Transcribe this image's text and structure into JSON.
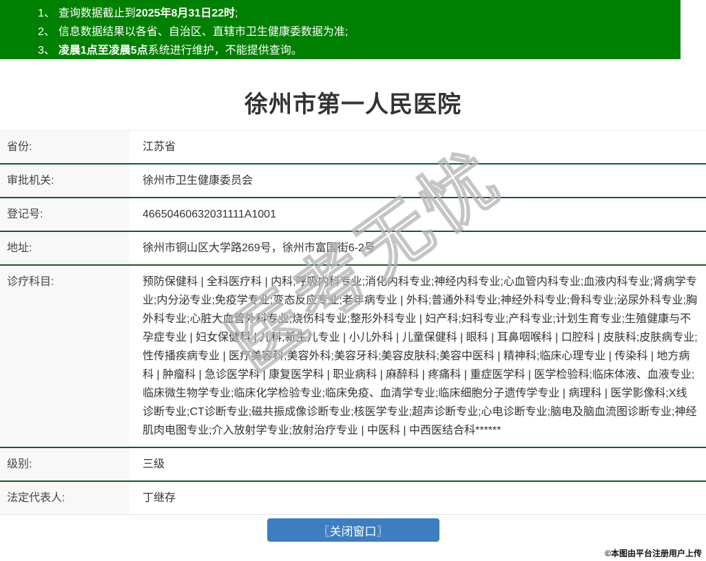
{
  "banner": {
    "notices": [
      {
        "num": "1、",
        "pre": "查询数据截止到",
        "bold": "2025年8月31日22时",
        "post": ";"
      },
      {
        "num": "2、",
        "pre": "信息数据结果以各省、自治区、直辖市卫生健康委数据为准;",
        "bold": "",
        "post": ""
      },
      {
        "num": "3、",
        "pre": "",
        "bold": "凌晨1点至凌晨5点",
        "post": "系统进行维护，不能提供查询。"
      }
    ]
  },
  "page": {
    "title": "徐州市第一人民医院"
  },
  "table": {
    "rows": [
      {
        "label": "省份:",
        "value": "江苏省"
      },
      {
        "label": "审批机关:",
        "value": "徐州市卫生健康委员会"
      },
      {
        "label": "登记号:",
        "value": "46650460632031111A1001"
      },
      {
        "label": "地址:",
        "value": "徐州市铜山区大学路269号，徐州市富国街6-2号"
      },
      {
        "label": "诊疗科目:",
        "value": "预防保健科 | 全科医疗科 | 内科;呼吸内科专业;消化内科专业;神经内科专业;心血管内科专业;血液内科专业;肾病学专业;内分泌专业;免疫学专业;变态反应专业;老年病专业 | 外科;普通外科专业;神经外科专业;骨科专业;泌尿外科专业;胸外科专业;心脏大血管外科专业;烧伤科专业;整形外科专业 | 妇产科;妇科专业;产科专业;计划生育专业;生殖健康与不孕症专业 | 妇女保健科 | 儿科;新生儿专业 | 小儿外科 | 儿童保健科 | 眼科 | 耳鼻咽喉科 | 口腔科 | 皮肤科;皮肤病专业;性传播疾病专业 | 医疗美容科;美容外科;美容牙科;美容皮肤科;美容中医科 | 精神科;临床心理专业 | 传染科 | 地方病科 | 肿瘤科 | 急诊医学科 | 康复医学科 | 职业病科 | 麻醉科 | 疼痛科 | 重症医学科 | 医学检验科;临床体液、血液专业;临床微生物学专业;临床化学检验专业;临床免疫、血清学专业;临床细胞分子遗传学专业 | 病理科 | 医学影像科;X线诊断专业;CT诊断专业;磁共振成像诊断专业;核医学专业;超声诊断专业;心电诊断专业;脑电及脑血流图诊断专业;神经肌肉电图专业;介入放射学专业;放射治疗专业 | 中医科 | 中西医结合科******"
      },
      {
        "label": "级别:",
        "value": "三级"
      },
      {
        "label": "法定代表人:",
        "value": "丁继存"
      }
    ]
  },
  "watermark": {
    "text": "医考无忧"
  },
  "button": {
    "close_label": "〖关闭窗口〗"
  },
  "footer": {
    "credit": "©本图由平台注册用户上传"
  },
  "colors": {
    "banner_green": "#008000",
    "separator_green": "#0d5c26",
    "label_bg": "#f8f8f8",
    "button_blue": "#3d7ec1",
    "text": "#333333"
  }
}
